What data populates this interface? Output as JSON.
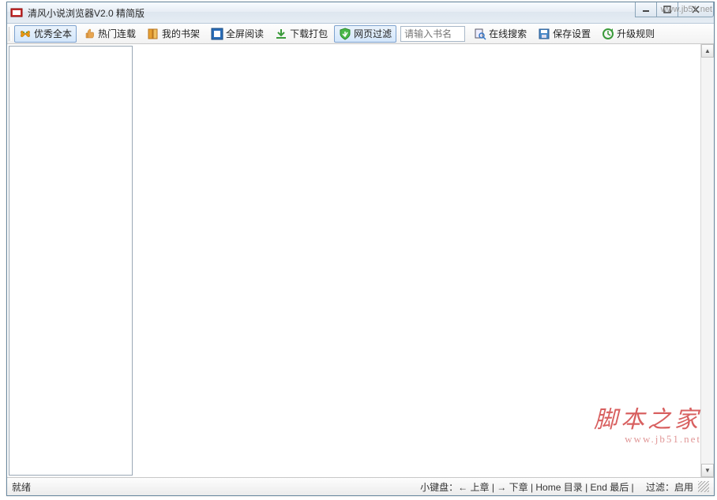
{
  "window": {
    "title": "清风小说浏览器V2.0 精简版"
  },
  "toolbar": {
    "items": [
      {
        "label": "优秀全本",
        "icon": "butterfly"
      },
      {
        "label": "热门连载",
        "icon": "thumb"
      },
      {
        "label": "我的书架",
        "icon": "book"
      },
      {
        "label": "全屏阅读",
        "icon": "fullscreen"
      },
      {
        "label": "下载打包",
        "icon": "download"
      },
      {
        "label": "网页过滤",
        "icon": "shield"
      }
    ],
    "search_placeholder": "请输入书名",
    "right_items": [
      {
        "label": "在线搜索",
        "icon": "search"
      },
      {
        "label": "保存设置",
        "icon": "save"
      },
      {
        "label": "升级规则",
        "icon": "update"
      }
    ]
  },
  "status": {
    "left": "就绪",
    "right": "小键盘：← 上章 | → 下章 | Home 目录 | End 最后 | 　过滤：启用"
  },
  "watermark": {
    "title": "脚本之家",
    "url": "www.jb51.net",
    "top_right": "www.jb51.net"
  }
}
